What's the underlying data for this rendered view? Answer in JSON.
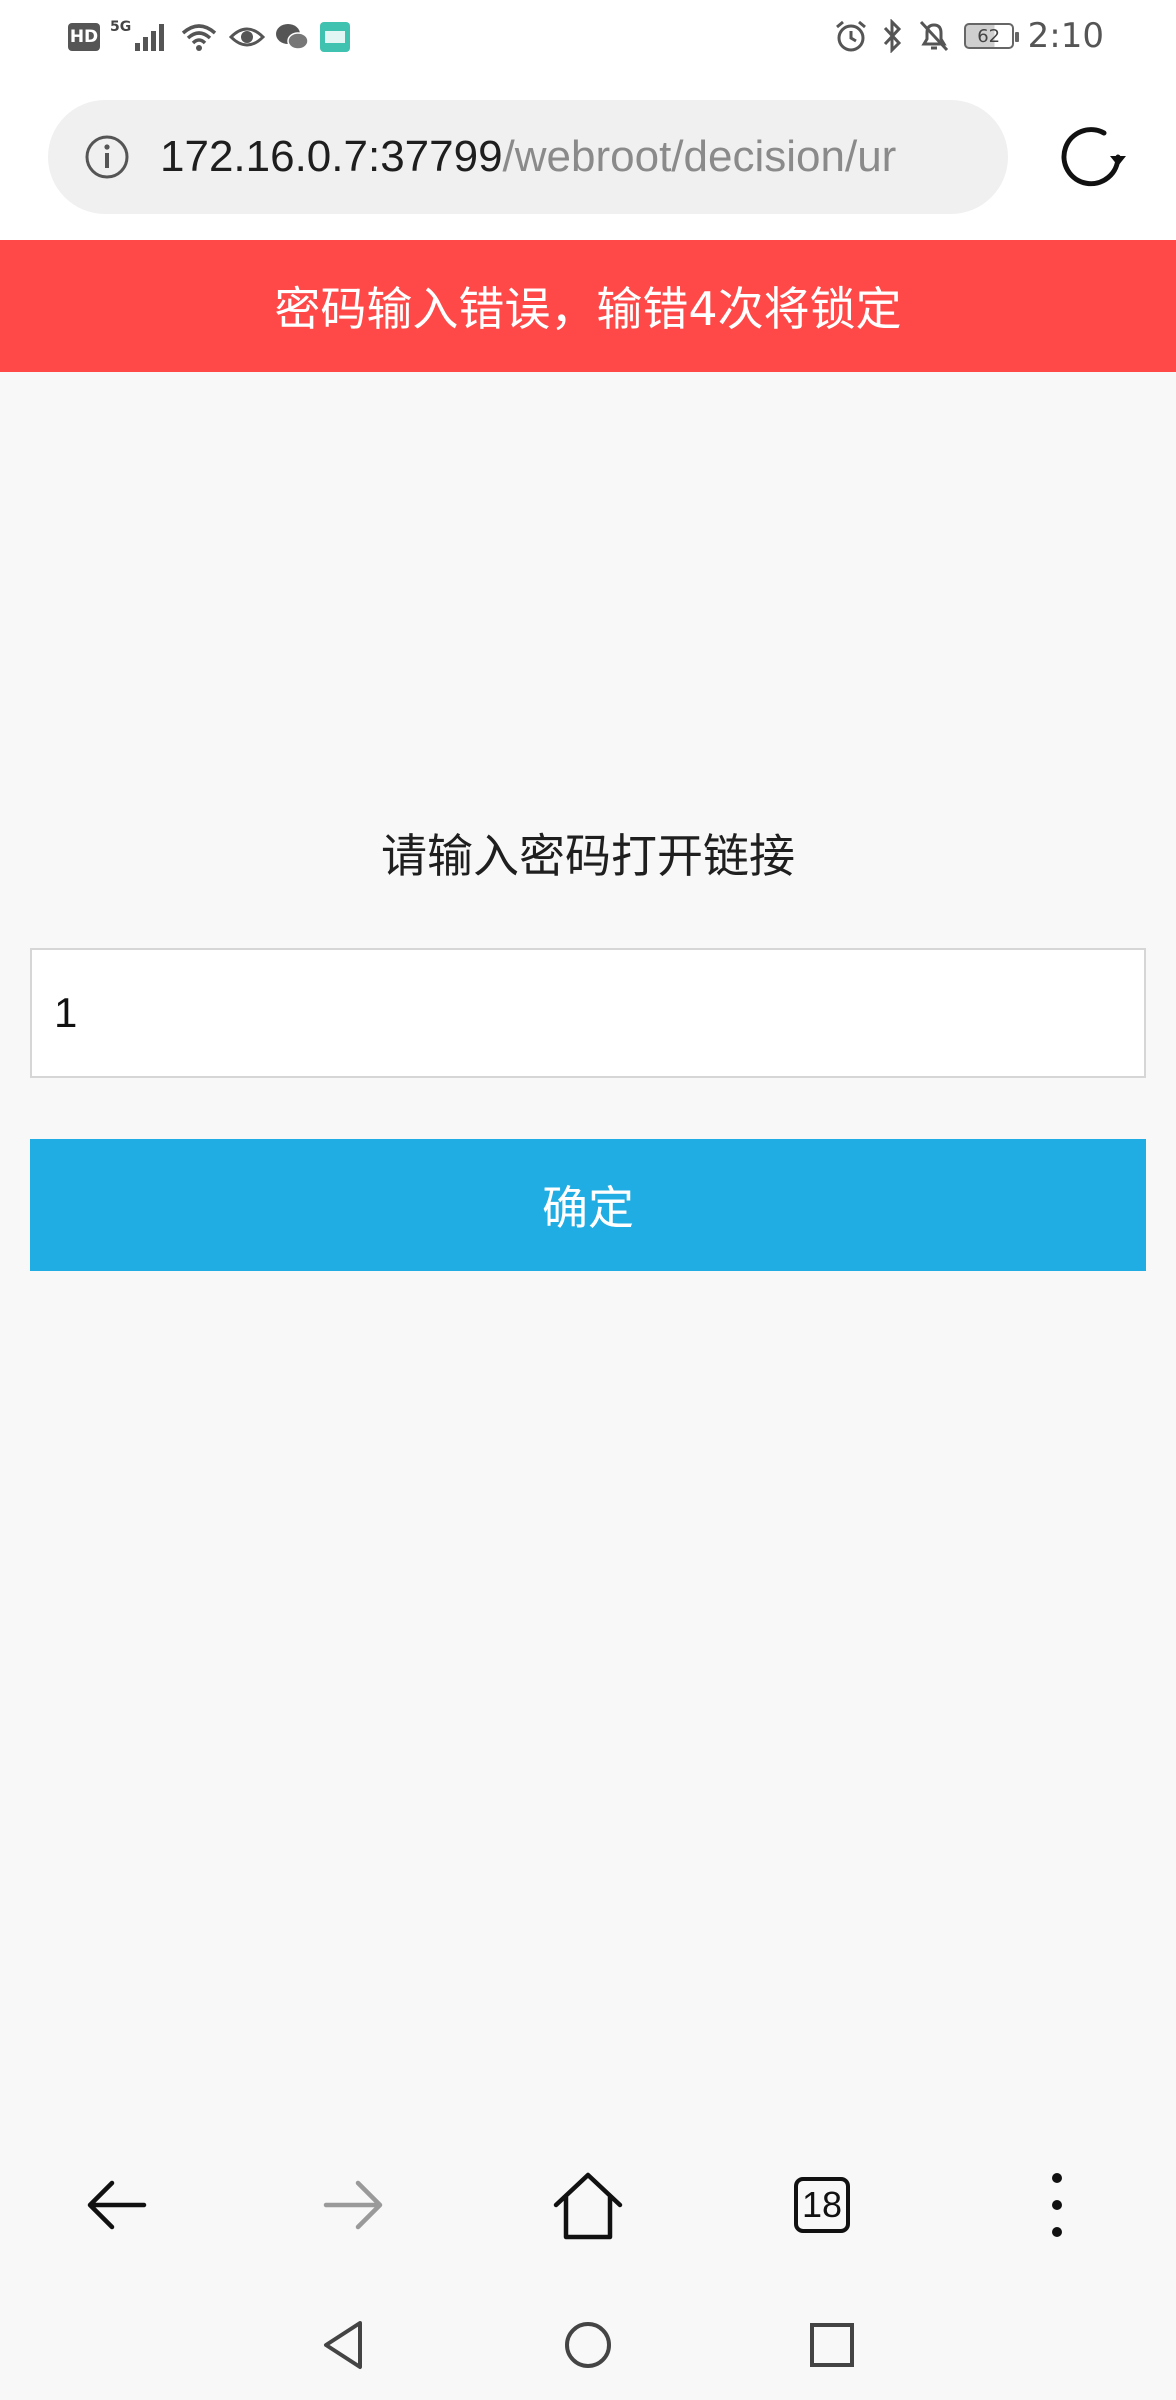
{
  "status_bar": {
    "hd_label": "HD",
    "network_label": "5G",
    "battery_level": "62",
    "time": "2:10",
    "left_icons": [
      "hd-icon",
      "signal-icon",
      "wifi-icon",
      "eye-icon",
      "wechat-icon",
      "boss-app-icon"
    ],
    "right_icons": [
      "alarm-icon",
      "bluetooth-icon",
      "bell-off-icon",
      "battery-icon"
    ]
  },
  "browser": {
    "url_host": "172.16.0.7:37799",
    "url_path": "/webroot/decision/ur",
    "left_icon": "info-icon",
    "right_icon": "reload-icon"
  },
  "error_banner": {
    "text": "密码输入错误，输错4次将锁定",
    "color": "#ff4848"
  },
  "password_form": {
    "prompt": "请输入密码打开链接",
    "input_value": "1",
    "confirm_label": "确定",
    "button_color": "#1fade3"
  },
  "bottom_nav": {
    "tab_count": "18",
    "icons": [
      "back-arrow-icon",
      "forward-arrow-icon",
      "home-icon",
      "tabs-icon",
      "more-icon"
    ]
  },
  "system_nav": {
    "icons": [
      "back-triangle-icon",
      "home-circle-icon",
      "recents-square-icon"
    ]
  }
}
